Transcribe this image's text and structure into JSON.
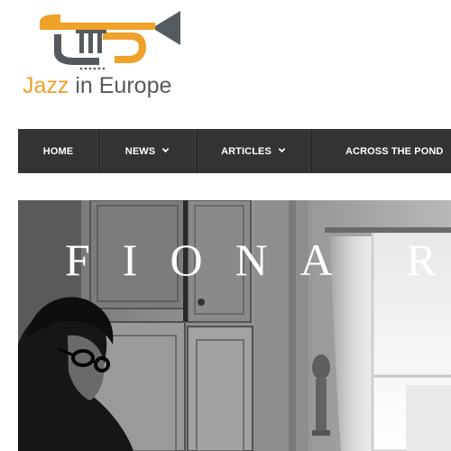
{
  "header": {
    "logo": {
      "icon": "trumpet-icon",
      "text_part1": "Jazz",
      "text_part2": " in Europe",
      "colors": {
        "trumpet_orange": "#f0a12a",
        "trumpet_gray": "#555a5f"
      }
    }
  },
  "nav": {
    "background": "#333333",
    "items": [
      {
        "label": "HOME",
        "has_dropdown": false
      },
      {
        "label": "NEWS",
        "has_dropdown": true,
        "icon": "chevron-down-icon"
      },
      {
        "label": "ARTICLES",
        "has_dropdown": true,
        "icon": "chevron-down-icon"
      },
      {
        "label": "ACROSS THE POND",
        "has_dropdown": false
      }
    ]
  },
  "hero": {
    "title": "FIONA RO",
    "style": "black-and-white photo"
  }
}
